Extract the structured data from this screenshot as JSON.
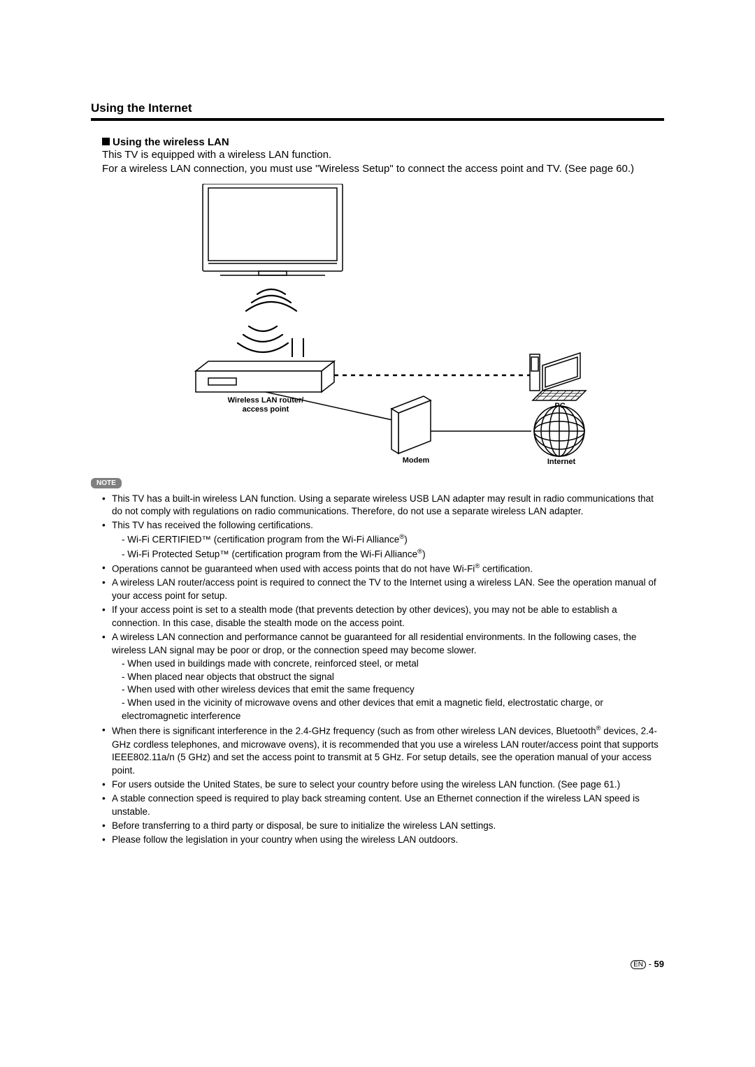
{
  "section_title": "Using the Internet",
  "subhead": "Using the wireless LAN",
  "intro1": "This TV is equipped with a wireless LAN function.",
  "intro2": "For a wireless LAN connection, you must use \"Wireless Setup\" to connect the access point and TV. (See page 60.)",
  "diagram": {
    "router": "Wireless LAN router/\naccess point",
    "modem": "Modem",
    "pc": "PC",
    "internet": "Internet"
  },
  "note_label": "NOTE",
  "notes": {
    "n1": "This TV has a built-in wireless LAN function. Using a separate wireless USB LAN adapter may result in radio communications that do not comply with regulations on radio communications. Therefore, do not use a separate wireless LAN adapter.",
    "n2": "This TV has received the following certifications.",
    "n2a": "- Wi-Fi CERTIFIED™ (certification program from the Wi-Fi Alliance",
    "n2b": "- Wi-Fi Protected Setup™ (certification program from the Wi-Fi Alliance",
    "n3a": "Operations cannot be guaranteed when used with access points that do not have Wi-Fi",
    "n3b": " certification.",
    "n4": "A wireless LAN router/access point is required to connect the TV to the Internet using a wireless LAN. See the operation manual of your access point for setup.",
    "n5": "If your access point is set to a stealth mode (that prevents detection by other devices), you may not be able to establish a connection. In this case, disable the stealth mode on the access point.",
    "n6": "A wireless LAN connection and performance cannot be guaranteed for all residential environments. In the following cases, the wireless LAN signal may be poor or drop, or the connection speed may become slower.",
    "n6a": "- When used in buildings made with concrete, reinforced steel, or metal",
    "n6b": "- When placed near objects that obstruct the signal",
    "n6c": "- When used with other wireless devices that emit the same frequency",
    "n6d": "- When used in the vicinity of microwave ovens and other devices that emit a magnetic field, electrostatic charge, or electromagnetic interference",
    "n7a": "When there is significant interference in the 2.4-GHz frequency (such as from other wireless LAN devices, Bluetooth",
    "n7b": " devices, 2.4-GHz cordless telephones, and microwave ovens), it is recommended that you use a wireless LAN router/access point that supports IEEE802.11a/n (5 GHz) and set the access point to transmit at 5 GHz. For setup details, see the operation manual of your access point.",
    "n8": "For users outside the United States, be sure to select your country before using the wireless LAN function. (See page 61.)",
    "n9": "A stable connection speed is required to play back streaming content. Use an Ethernet connection if the wireless LAN speed is unstable.",
    "n10": "Before transferring to a third party or disposal, be sure to initialize the wireless LAN settings.",
    "n11": "Please follow the legislation in your country when using the wireless LAN outdoors."
  },
  "footer": {
    "lang": "EN",
    "sep": " - ",
    "page": "59"
  }
}
